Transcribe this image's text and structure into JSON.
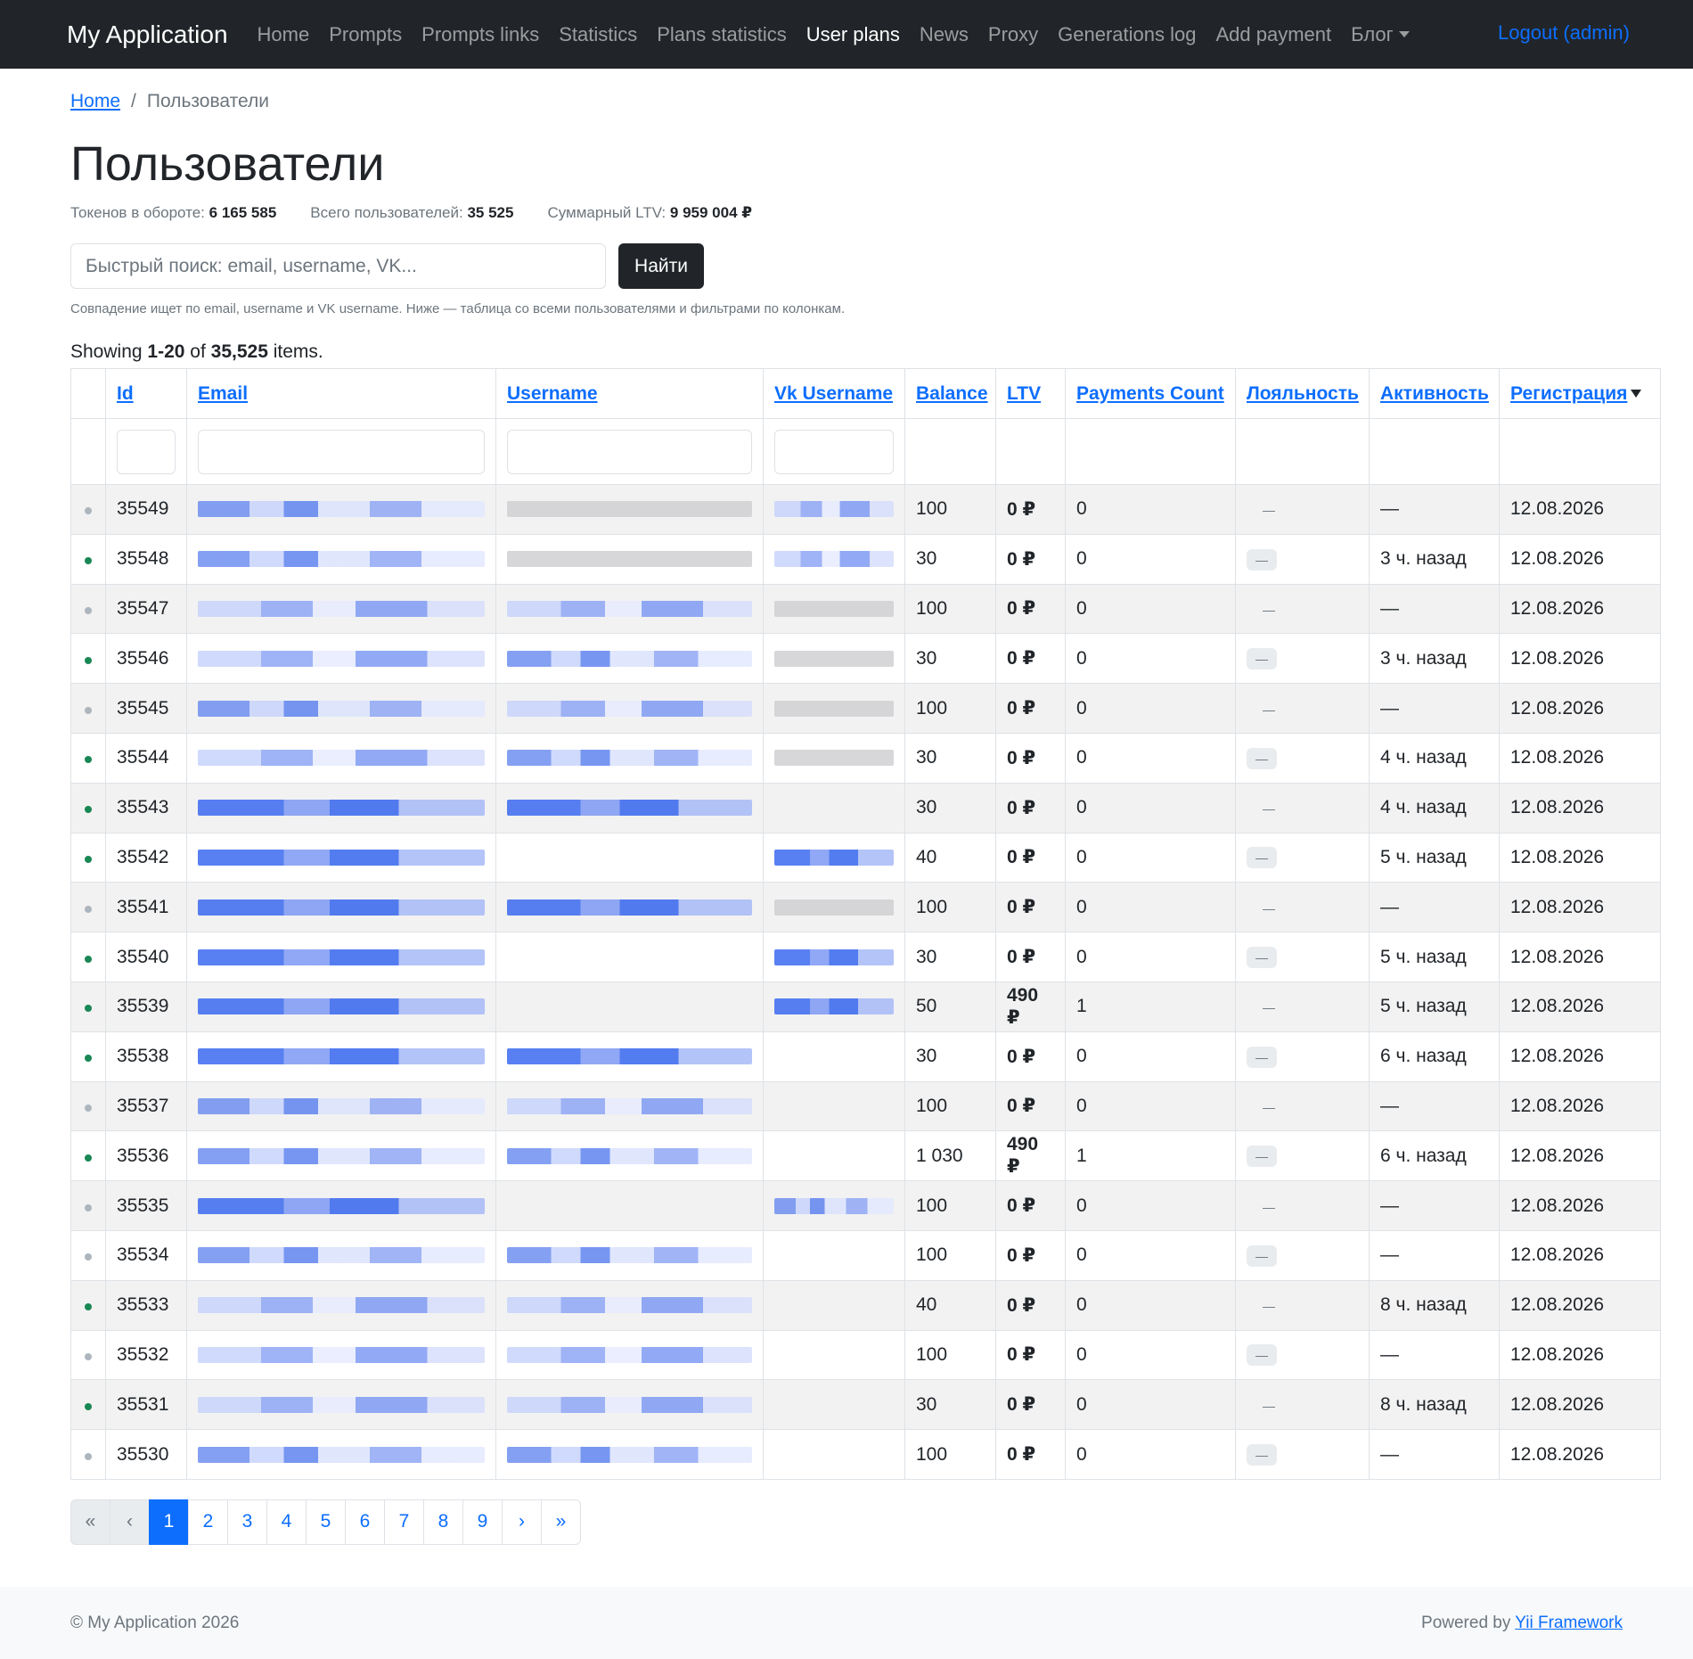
{
  "navbar": {
    "brand": "My Application",
    "items": [
      {
        "label": "Home",
        "active": false
      },
      {
        "label": "Prompts",
        "active": false
      },
      {
        "label": "Prompts links",
        "active": false
      },
      {
        "label": "Statistics",
        "active": false
      },
      {
        "label": "Plans statistics",
        "active": false
      },
      {
        "label": "User plans",
        "active": true
      },
      {
        "label": "News",
        "active": false
      },
      {
        "label": "Proxy",
        "active": false
      },
      {
        "label": "Generations log",
        "active": false
      },
      {
        "label": "Add payment",
        "active": false
      }
    ],
    "dropdown_label": "Блог",
    "logout": "Logout (admin)"
  },
  "breadcrumb": {
    "home": "Home",
    "separator": "/",
    "current": "Пользователи"
  },
  "page_title": "Пользователи",
  "stats": {
    "tokens_label": "Токенов в обороте:",
    "tokens_value": "6 165 585",
    "users_label": "Всего пользователей:",
    "users_value": "35 525",
    "ltv_label": "Суммарный LTV:",
    "ltv_value": "9 959 004 ₽"
  },
  "search": {
    "placeholder": "Быстрый поиск: email, username, VK...",
    "button": "Найти",
    "hint": "Совпадение ищет по email, username и VK username. Ниже — таблица со всеми пользователями и фильтрами по колонкам."
  },
  "summary": {
    "prefix": "Showing",
    "range": "1-20",
    "of": "of",
    "total": "35,525",
    "suffix": "items."
  },
  "table": {
    "columns": [
      "Id",
      "Email",
      "Username",
      "Vk Username",
      "Balance",
      "LTV",
      "Payments Count",
      "Лояльность",
      "Активность",
      "Регистрация"
    ],
    "rows": [
      {
        "online": false,
        "id": "35549",
        "email_blur": "b1",
        "user_blur": "b4",
        "vk_blur": "b2",
        "balance": "100",
        "ltv": "0 ₽",
        "payments": "0",
        "loyalty_badge": false,
        "loyalty": "—",
        "activity": "—",
        "reg": "12.08.2026"
      },
      {
        "online": true,
        "id": "35548",
        "email_blur": "b1",
        "user_blur": "b4",
        "vk_blur": "b2",
        "balance": "30",
        "ltv": "0 ₽",
        "payments": "0",
        "loyalty_badge": true,
        "loyalty": "—",
        "activity": "3 ч. назад",
        "reg": "12.08.2026"
      },
      {
        "online": false,
        "id": "35547",
        "email_blur": "b2",
        "user_blur": "b2",
        "vk_blur": "b4",
        "balance": "100",
        "ltv": "0 ₽",
        "payments": "0",
        "loyalty_badge": false,
        "loyalty": "—",
        "activity": "—",
        "reg": "12.08.2026"
      },
      {
        "online": true,
        "id": "35546",
        "email_blur": "b2",
        "user_blur": "b1",
        "vk_blur": "b4",
        "balance": "30",
        "ltv": "0 ₽",
        "payments": "0",
        "loyalty_badge": true,
        "loyalty": "—",
        "activity": "3 ч. назад",
        "reg": "12.08.2026"
      },
      {
        "online": false,
        "id": "35545",
        "email_blur": "b1",
        "user_blur": "b2",
        "vk_blur": "b4",
        "balance": "100",
        "ltv": "0 ₽",
        "payments": "0",
        "loyalty_badge": false,
        "loyalty": "—",
        "activity": "—",
        "reg": "12.08.2026"
      },
      {
        "online": true,
        "id": "35544",
        "email_blur": "b2",
        "user_blur": "b1",
        "vk_blur": "b4",
        "balance": "30",
        "ltv": "0 ₽",
        "payments": "0",
        "loyalty_badge": true,
        "loyalty": "—",
        "activity": "4 ч. назад",
        "reg": "12.08.2026"
      },
      {
        "online": true,
        "id": "35543",
        "email_blur": "b3",
        "user_blur": "b3",
        "vk_blur": "",
        "balance": "30",
        "ltv": "0 ₽",
        "payments": "0",
        "loyalty_badge": false,
        "loyalty": "—",
        "activity": "4 ч. назад",
        "reg": "12.08.2026"
      },
      {
        "online": true,
        "id": "35542",
        "email_blur": "b3",
        "user_blur": "",
        "vk_blur": "b3",
        "balance": "40",
        "ltv": "0 ₽",
        "payments": "0",
        "loyalty_badge": true,
        "loyalty": "—",
        "activity": "5 ч. назад",
        "reg": "12.08.2026"
      },
      {
        "online": false,
        "id": "35541",
        "email_blur": "b3",
        "user_blur": "b3",
        "vk_blur": "b4",
        "balance": "100",
        "ltv": "0 ₽",
        "payments": "0",
        "loyalty_badge": false,
        "loyalty": "—",
        "activity": "—",
        "reg": "12.08.2026"
      },
      {
        "online": true,
        "id": "35540",
        "email_blur": "b3",
        "user_blur": "",
        "vk_blur": "b3",
        "balance": "30",
        "ltv": "0 ₽",
        "payments": "0",
        "loyalty_badge": true,
        "loyalty": "—",
        "activity": "5 ч. назад",
        "reg": "12.08.2026"
      },
      {
        "online": true,
        "id": "35539",
        "email_blur": "b3",
        "user_blur": "",
        "vk_blur": "b3",
        "balance": "50",
        "ltv": "490 ₽",
        "payments": "1",
        "loyalty_badge": false,
        "loyalty": "—",
        "activity": "5 ч. назад",
        "reg": "12.08.2026"
      },
      {
        "online": true,
        "id": "35538",
        "email_blur": "b3",
        "user_blur": "b3",
        "vk_blur": "",
        "balance": "30",
        "ltv": "0 ₽",
        "payments": "0",
        "loyalty_badge": true,
        "loyalty": "—",
        "activity": "6 ч. назад",
        "reg": "12.08.2026"
      },
      {
        "online": false,
        "id": "35537",
        "email_blur": "b1",
        "user_blur": "b2",
        "vk_blur": "",
        "balance": "100",
        "ltv": "0 ₽",
        "payments": "0",
        "loyalty_badge": false,
        "loyalty": "—",
        "activity": "—",
        "reg": "12.08.2026"
      },
      {
        "online": true,
        "id": "35536",
        "email_blur": "b1",
        "user_blur": "b1",
        "vk_blur": "",
        "balance": "1 030",
        "ltv": "490 ₽",
        "payments": "1",
        "loyalty_badge": true,
        "loyalty": "—",
        "activity": "6 ч. назад",
        "reg": "12.08.2026"
      },
      {
        "online": false,
        "id": "35535",
        "email_blur": "b3",
        "user_blur": "",
        "vk_blur": "b1",
        "balance": "100",
        "ltv": "0 ₽",
        "payments": "0",
        "loyalty_badge": false,
        "loyalty": "—",
        "activity": "—",
        "reg": "12.08.2026"
      },
      {
        "online": false,
        "id": "35534",
        "email_blur": "b1",
        "user_blur": "b1",
        "vk_blur": "",
        "balance": "100",
        "ltv": "0 ₽",
        "payments": "0",
        "loyalty_badge": true,
        "loyalty": "—",
        "activity": "—",
        "reg": "12.08.2026"
      },
      {
        "online": true,
        "id": "35533",
        "email_blur": "b2",
        "user_blur": "b2",
        "vk_blur": "",
        "balance": "40",
        "ltv": "0 ₽",
        "payments": "0",
        "loyalty_badge": false,
        "loyalty": "—",
        "activity": "8 ч. назад",
        "reg": "12.08.2026"
      },
      {
        "online": false,
        "id": "35532",
        "email_blur": "b2",
        "user_blur": "b2",
        "vk_blur": "",
        "balance": "100",
        "ltv": "0 ₽",
        "payments": "0",
        "loyalty_badge": true,
        "loyalty": "—",
        "activity": "—",
        "reg": "12.08.2026"
      },
      {
        "online": true,
        "id": "35531",
        "email_blur": "b2",
        "user_blur": "b2",
        "vk_blur": "",
        "balance": "30",
        "ltv": "0 ₽",
        "payments": "0",
        "loyalty_badge": false,
        "loyalty": "—",
        "activity": "8 ч. назад",
        "reg": "12.08.2026"
      },
      {
        "online": false,
        "id": "35530",
        "email_blur": "b1",
        "user_blur": "b1",
        "vk_blur": "",
        "balance": "100",
        "ltv": "0 ₽",
        "payments": "0",
        "loyalty_badge": true,
        "loyalty": "—",
        "activity": "—",
        "reg": "12.08.2026"
      }
    ]
  },
  "pagination": {
    "first": "«",
    "prev": "‹",
    "pages": [
      "1",
      "2",
      "3",
      "4",
      "5",
      "6",
      "7",
      "8",
      "9"
    ],
    "active_page": "1",
    "next": "›",
    "last": "»"
  },
  "footer": {
    "copyright": "© My Application 2026",
    "powered_prefix": "Powered by",
    "powered_link": "Yii Framework"
  }
}
